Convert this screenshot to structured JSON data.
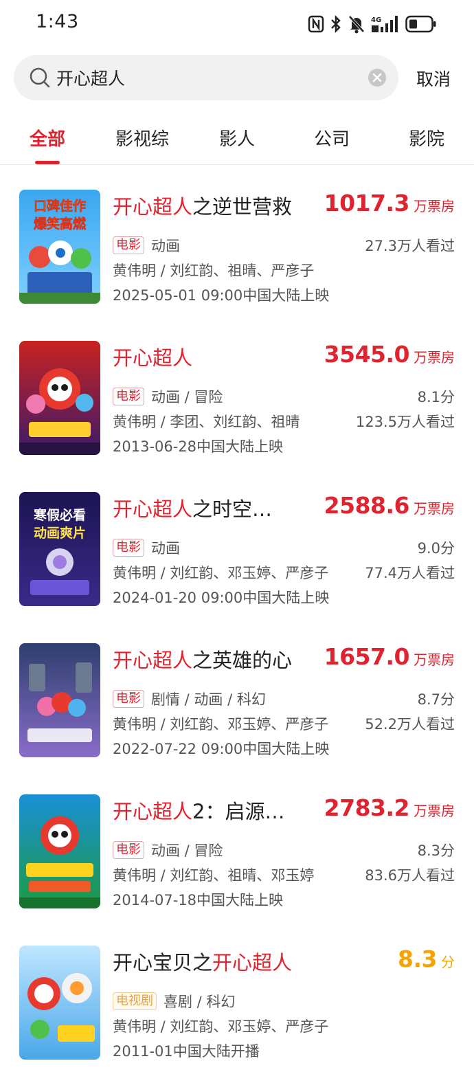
{
  "status_bar": {
    "time": "1:43",
    "icons": [
      "nfc-icon",
      "bluetooth-icon",
      "mute-icon",
      "4g-signal-icon",
      "battery-icon"
    ]
  },
  "search": {
    "value": "开心超人",
    "cancel_label": "取消"
  },
  "tabs": [
    {
      "label": "全部",
      "active": true
    },
    {
      "label": "影视综",
      "active": false
    },
    {
      "label": "影人",
      "active": false
    },
    {
      "label": "公司",
      "active": false
    },
    {
      "label": "影院",
      "active": false
    }
  ],
  "colors": {
    "accent": "#e0242f",
    "score_gold": "#f4a300"
  },
  "results": [
    {
      "title_pre": "",
      "title_hl": "开心超人",
      "title_post": "之逆世营救",
      "value": "1017.3",
      "unit": "万票房",
      "badge": "电影",
      "genre": "动画",
      "right1": "27.3万人看过",
      "right2": "",
      "cast": "黄伟明 / 刘红韵、祖晴、严彦子",
      "release": "2025-05-01 09:00中国大陆上映",
      "poster_text1": "口碑佳作",
      "poster_text2": "爆笑高燃"
    },
    {
      "title_pre": "",
      "title_hl": "开心超人",
      "title_post": "",
      "value": "3545.0",
      "unit": "万票房",
      "badge": "电影",
      "genre": "动画 / 冒险",
      "right1": "8.1分",
      "right2": "123.5万人看过",
      "cast": "黄伟明 / 李团、刘红韵、祖晴",
      "release": "2013-06-28中国大陆上映",
      "poster_text1": "",
      "poster_text2": ""
    },
    {
      "title_pre": "",
      "title_hl": "开心超人",
      "title_post": "之时空…",
      "value": "2588.6",
      "unit": "万票房",
      "badge": "电影",
      "genre": "动画",
      "right1": "9.0分",
      "right2": "77.4万人看过",
      "cast": "黄伟明 / 刘红韵、邓玉婷、严彦子",
      "release": "2024-01-20 09:00中国大陆上映",
      "poster_text1": "寒假必看",
      "poster_text2": "动画爽片"
    },
    {
      "title_pre": "",
      "title_hl": "开心超人",
      "title_post": "之英雄的心",
      "value": "1657.0",
      "unit": "万票房",
      "badge": "电影",
      "genre": "剧情 / 动画 / 科幻",
      "right1": "8.7分",
      "right2": "52.2万人看过",
      "cast": "黄伟明 / 刘红韵、邓玉婷、严彦子",
      "release": "2022-07-22 09:00中国大陆上映",
      "poster_text1": "",
      "poster_text2": ""
    },
    {
      "title_pre": "",
      "title_hl": "开心超人",
      "title_post": "2：启源…",
      "value": "2783.2",
      "unit": "万票房",
      "badge": "电影",
      "genre": "动画 / 冒险",
      "right1": "8.3分",
      "right2": "83.6万人看过",
      "cast": "黄伟明 / 刘红韵、祖晴、邓玉婷",
      "release": "2014-07-18中国大陆上映",
      "poster_text1": "",
      "poster_text2": ""
    },
    {
      "title_pre": "开心宝贝之",
      "title_hl": "开心超人",
      "title_post": "",
      "value": "8.3",
      "unit": "分",
      "badge": "电视剧",
      "genre": "喜剧 / 科幻",
      "right1": "",
      "right2": "",
      "cast": "黄伟明 / 刘红韵、邓玉婷、严彦子",
      "release": "2011-01中国大陆开播",
      "poster_text1": "",
      "poster_text2": ""
    }
  ]
}
